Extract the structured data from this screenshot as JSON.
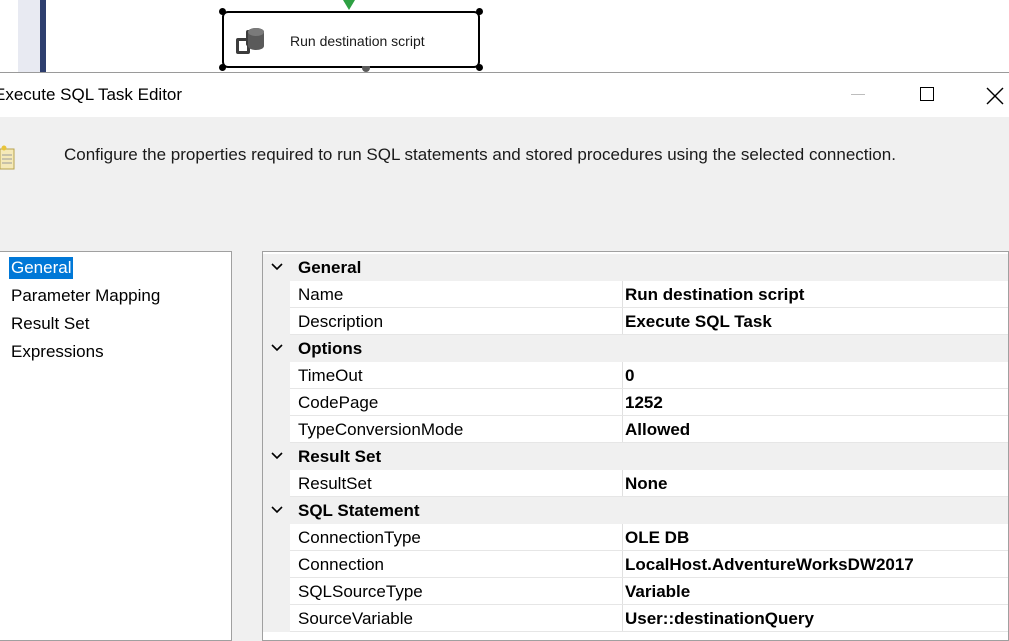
{
  "designer": {
    "task_label": "Run destination script"
  },
  "dialog": {
    "title": "Execute SQL Task Editor",
    "description": "Configure the properties required to run SQL statements and stored procedures using the selected connection."
  },
  "nav": {
    "items": [
      {
        "label": "General",
        "selected": true
      },
      {
        "label": "Parameter Mapping",
        "selected": false
      },
      {
        "label": "Result Set",
        "selected": false
      },
      {
        "label": "Expressions",
        "selected": false
      }
    ]
  },
  "properties": {
    "general": {
      "label": "General",
      "name": {
        "name": "Name",
        "value": "Run destination script"
      },
      "description": {
        "name": "Description",
        "value": "Execute SQL Task"
      }
    },
    "options": {
      "label": "Options",
      "timeout": {
        "name": "TimeOut",
        "value": "0"
      },
      "codepage": {
        "name": "CodePage",
        "value": "1252"
      },
      "typeconversion": {
        "name": "TypeConversionMode",
        "value": "Allowed"
      }
    },
    "resultset": {
      "label": "Result Set",
      "resultset": {
        "name": "ResultSet",
        "value": "None"
      }
    },
    "sql": {
      "label": "SQL Statement",
      "connectiontype": {
        "name": "ConnectionType",
        "value": "OLE DB"
      },
      "connection": {
        "name": "Connection",
        "value": "LocalHost.AdventureWorksDW2017"
      },
      "sqlsourcetype": {
        "name": "SQLSourceType",
        "value": "Variable"
      },
      "sourcevariable": {
        "name": "SourceVariable",
        "value": "User::destinationQuery"
      }
    }
  },
  "icons": {
    "task": "sql-task-icon",
    "header": "wizard-icon",
    "minimize": "minimize-icon",
    "maximize": "maximize-icon",
    "close": "close-icon",
    "expand": "chevron-down-icon"
  },
  "colors": {
    "selection": "#0078d7",
    "precedence_arrow": "#2ea043"
  }
}
